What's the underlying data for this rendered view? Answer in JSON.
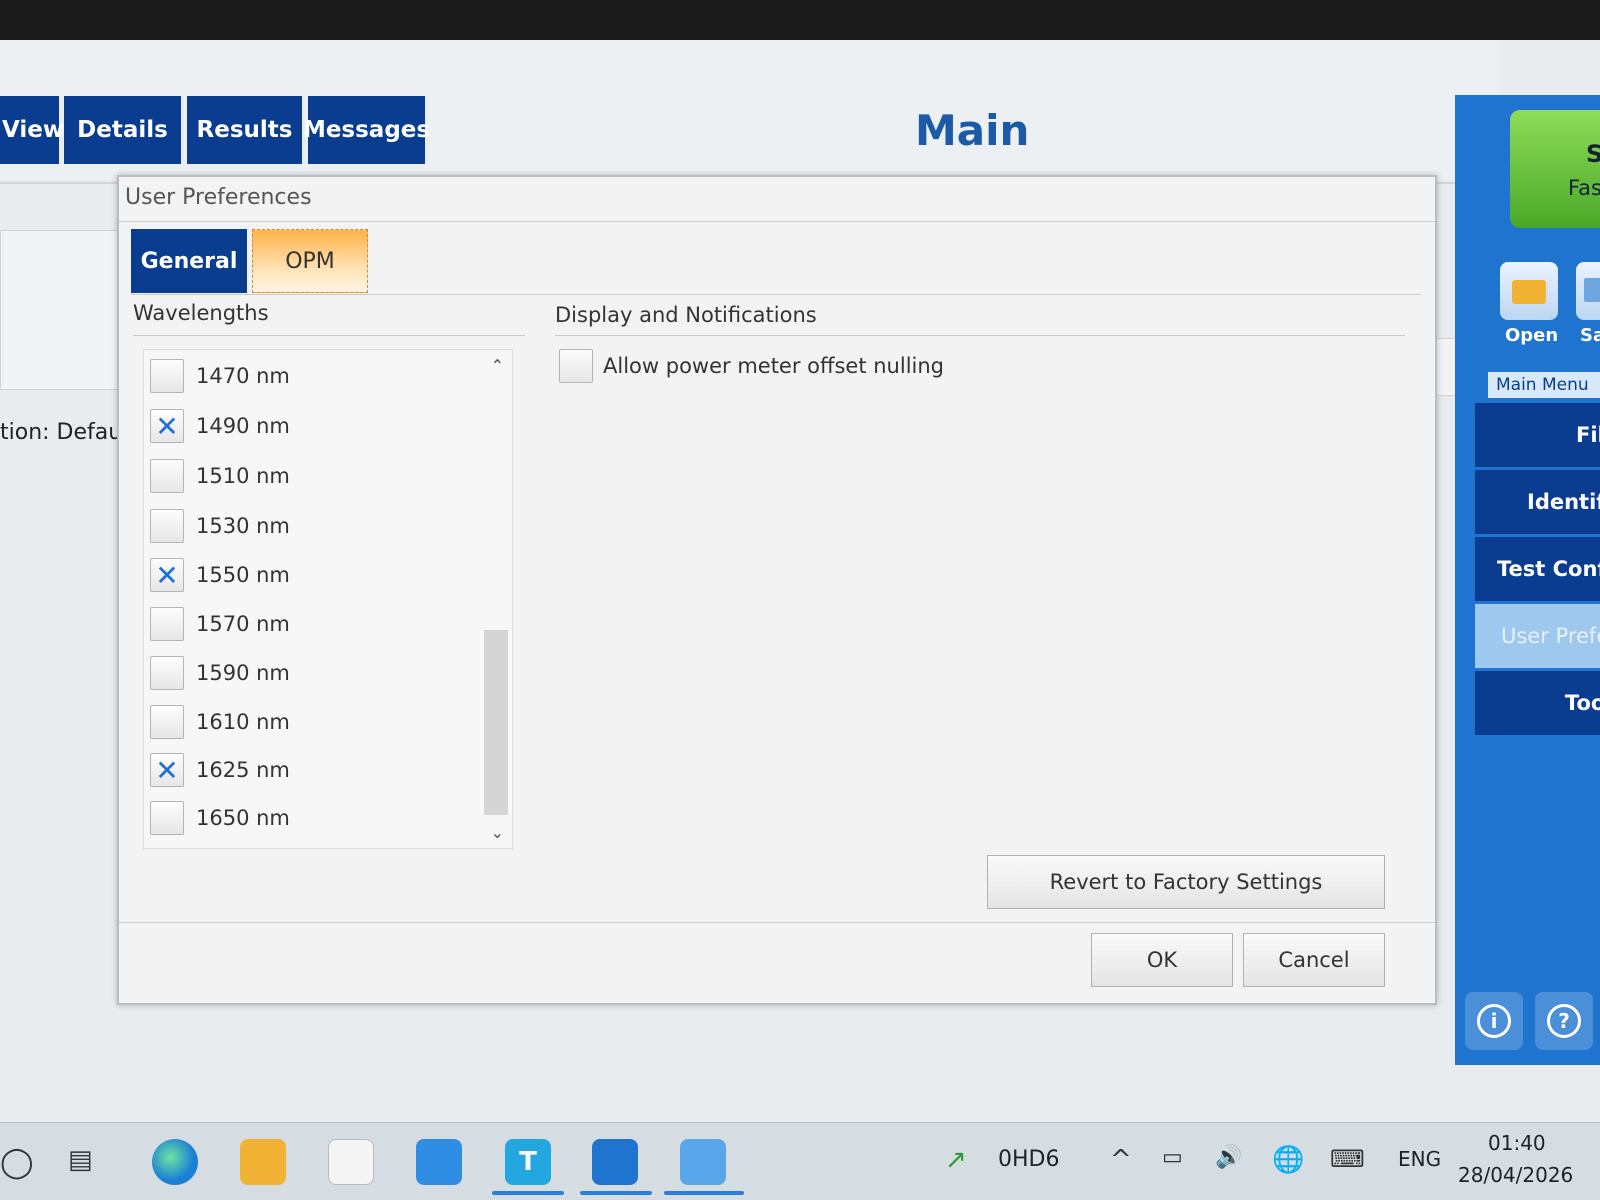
{
  "top_tabs": [
    "View",
    "Details",
    "Results",
    "Messages"
  ],
  "main_title": "Main",
  "background_config_text": "tion: Default",
  "sidebar": {
    "start_line1": "S",
    "start_line2": "Fas",
    "open_label": "Open",
    "save_label": "Sa",
    "menu_title": "Main Menu",
    "items": [
      {
        "label": "File"
      },
      {
        "label": "Identific"
      },
      {
        "label": "Test Config"
      },
      {
        "label": "User Prefe"
      },
      {
        "label": "Tools"
      }
    ],
    "info_glyph": "i",
    "help_glyph": "?"
  },
  "dialog": {
    "title": "User Preferences",
    "tabs": [
      "General",
      "OPM"
    ],
    "active_tab": "OPM",
    "wavelengths_label": "Wavelengths",
    "wavelengths": [
      {
        "label": "1470 nm",
        "checked": false,
        "mark": ""
      },
      {
        "label": "1490 nm",
        "checked": true,
        "mark": "✕"
      },
      {
        "label": "1510 nm",
        "checked": false,
        "mark": ""
      },
      {
        "label": "1530 nm",
        "checked": false,
        "mark": ""
      },
      {
        "label": "1550 nm",
        "checked": true,
        "mark": "✕"
      },
      {
        "label": "1570 nm",
        "checked": false,
        "mark": ""
      },
      {
        "label": "1590 nm",
        "checked": false,
        "mark": ""
      },
      {
        "label": "1610 nm",
        "checked": false,
        "mark": ""
      },
      {
        "label": "1625 nm",
        "checked": true,
        "mark": "✕"
      },
      {
        "label": "1650 nm",
        "checked": false,
        "mark": ""
      }
    ],
    "display_label": "Display and Notifications",
    "offset_label": "Allow power meter offset nulling",
    "offset_checked": false,
    "revert_button": "Revert to Factory Settings",
    "ok_button": "OK",
    "cancel_button": "Cancel"
  },
  "taskbar": {
    "app_letter": "T",
    "network_label": "0HD6",
    "caret": "^",
    "volume_glyph": "🔊",
    "lang": "ENG",
    "time": "01:40",
    "date": "28/04/2026"
  },
  "colors": {
    "tab_blue": "#0a3d8f",
    "sidebar_blue": "#1f74d0",
    "opm_orange": "#ffb347",
    "check_blue": "#1e6fd4",
    "start_green": "#5cb82f"
  }
}
